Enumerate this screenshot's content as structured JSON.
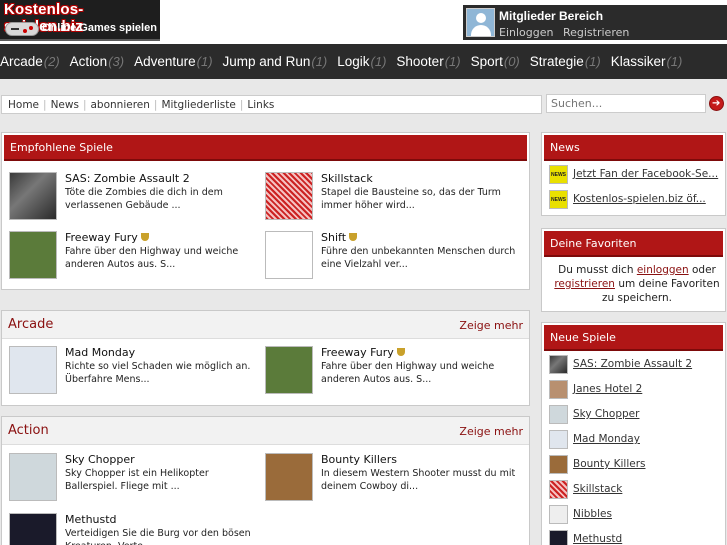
{
  "header": {
    "logo_title": "Kostenlos-spielen.biz",
    "logo_subtitle": "Online Games spielen",
    "member_title": "Mitglieder Bereich",
    "login_label": "Einloggen",
    "register_label": "Registrieren"
  },
  "nav": [
    {
      "label": "Arcade",
      "count": "(2)"
    },
    {
      "label": "Action",
      "count": "(3)"
    },
    {
      "label": "Adventure",
      "count": "(1)"
    },
    {
      "label": "Jump and Run",
      "count": "(1)"
    },
    {
      "label": "Logik",
      "count": "(1)"
    },
    {
      "label": "Shooter",
      "count": "(1)"
    },
    {
      "label": "Sport",
      "count": "(0)"
    },
    {
      "label": "Strategie",
      "count": "(1)"
    },
    {
      "label": "Klassiker",
      "count": "(1)"
    }
  ],
  "breadcrumb": [
    "Home",
    "News",
    "abonnieren",
    "Mitgliederliste",
    "Links"
  ],
  "search": {
    "placeholder": "Suchen..."
  },
  "featured": {
    "title": "Empfohlene Spiele",
    "games": [
      {
        "title": "SAS: Zombie Assault 2",
        "desc": "Töte die Zombies die dich in dem verlassenen Gebäude ..."
      },
      {
        "title": "Skillstack",
        "desc": "Stapel die Bausteine so, das der Turm immer höher wird..."
      },
      {
        "title": "Freeway Fury",
        "desc": "Fahre über den Highway und weiche anderen Autos aus. S..."
      },
      {
        "title": "Shift",
        "desc": "Führe den unbekannten Menschen durch eine Vielzahl ver..."
      }
    ]
  },
  "arcade": {
    "title": "Arcade",
    "more": "Zeige mehr",
    "games": [
      {
        "title": "Mad Monday",
        "desc": "Richte so viel Schaden wie möglich an. Überfahre Mens..."
      },
      {
        "title": "Freeway Fury",
        "desc": "Fahre über den Highway und weiche anderen Autos aus. S..."
      }
    ]
  },
  "action": {
    "title": "Action",
    "more": "Zeige mehr",
    "games": [
      {
        "title": "Sky Chopper",
        "desc": "Sky Chopper ist ein Helikopter Ballerspiel. Fliege mit ..."
      },
      {
        "title": "Bounty Killers",
        "desc": "In diesem Western Shooter musst du mit deinem Cowboy di..."
      },
      {
        "title": "Methustd",
        "desc": "Verteidigen Sie die Burg vor den bösen Kreaturen. Verte..."
      }
    ]
  },
  "sidebar": {
    "news_title": "News",
    "news": [
      "Jetzt Fan der Facebook-Se...",
      "Kostenlos-spielen.biz öf..."
    ],
    "fav_title": "Deine Favoriten",
    "fav_text_1": "Du musst dich",
    "fav_link_login": "einloggen",
    "fav_text_2": "oder",
    "fav_link_register": "registrieren",
    "fav_text_3": "um deine Favoriten zu speichern.",
    "new_title": "Neue Spiele",
    "new_games": [
      "SAS: Zombie Assault 2",
      "Janes Hotel 2",
      "Sky Chopper",
      "Mad Monday",
      "Bounty Killers",
      "Skillstack",
      "Nibbles",
      "Methustd"
    ]
  },
  "colors": {
    "accent_red": "#b01616",
    "dark_bar": "#2b2b2b",
    "heading_red": "#8a1010"
  }
}
